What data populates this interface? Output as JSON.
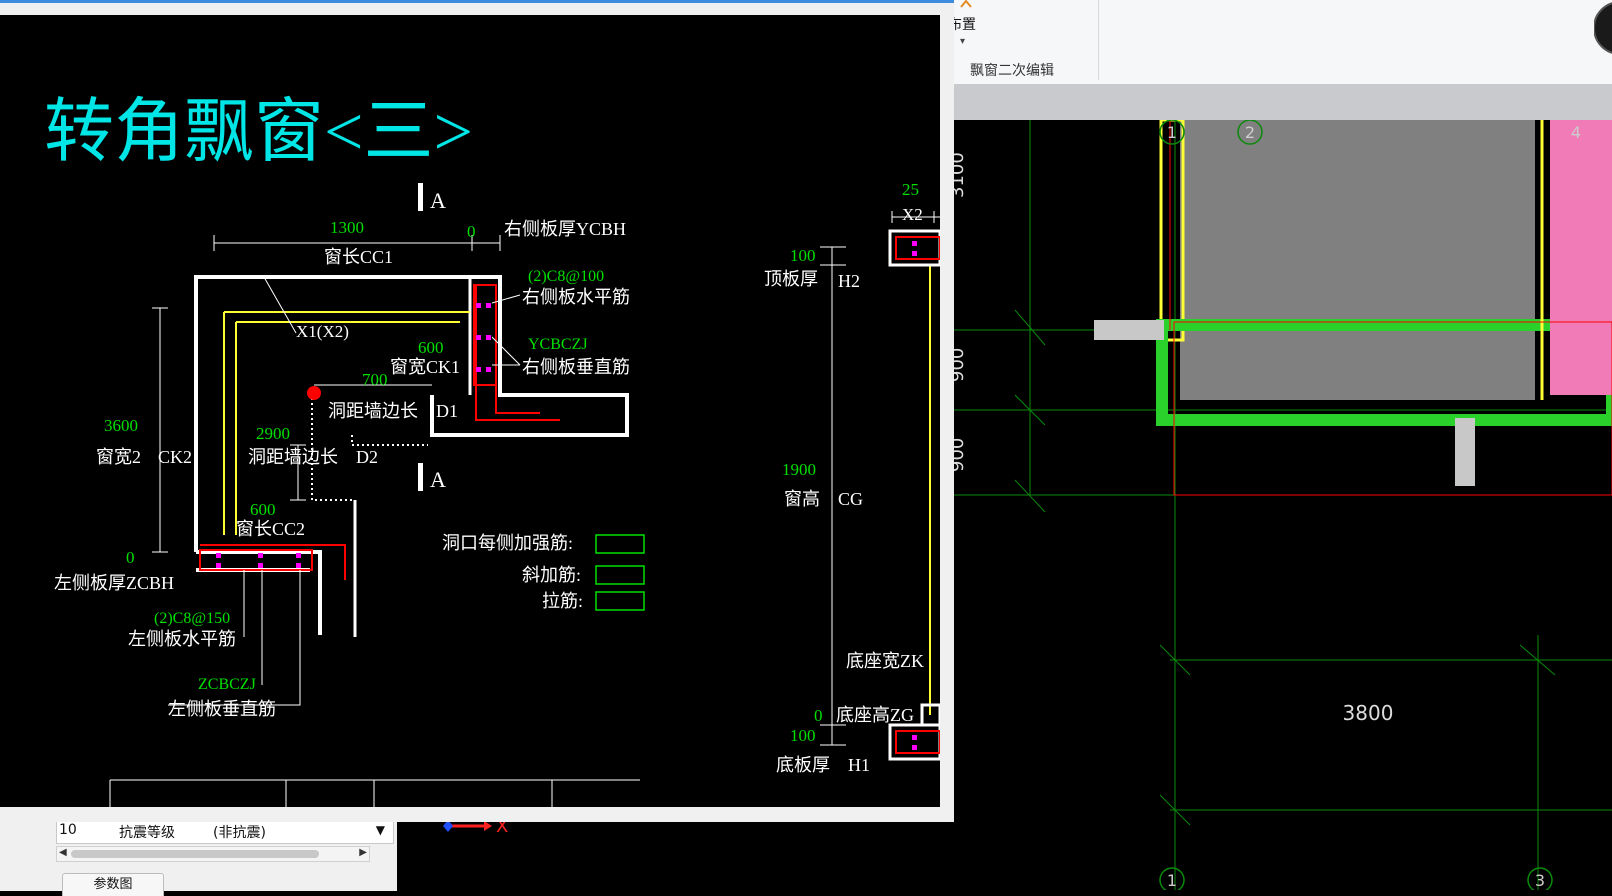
{
  "ribbon": {
    "button_label": "布置",
    "dropdown_arrow": "▾",
    "group_label": "飘窗二次编辑"
  },
  "diagram": {
    "title": "转角飘窗<三>",
    "section_mark": "A",
    "dims": {
      "cc1_value": "1300",
      "cc1_label": "窗长CC1",
      "ycbh_value": "0",
      "ycbh_label": "右侧板厚YCBH",
      "right_h_rebar": "(2)C8@100",
      "right_h_label": "右侧板水平筋",
      "x1x2": "X1(X2)",
      "ck1_value": "600",
      "ck1_label": "窗宽CK1",
      "ycbczj": "YCBCZJ",
      "right_v_label": "右侧板垂直筋",
      "d1_value": "700",
      "d1_label": "洞距墙边长",
      "d1_tag": "D1",
      "ck2_value": "3600",
      "ck2_label": "窗宽2",
      "ck2_tag": "CK2",
      "d2_value": "2900",
      "d2_label": "洞距墙边长",
      "d2_tag": "D2",
      "cc2_value": "600",
      "cc2_label": "窗长CC2",
      "zcbh_value": "0",
      "zcbh_label": "左侧板厚ZCBH",
      "left_h_rebar": "(2)C8@150",
      "left_h_label": "左侧板水平筋",
      "zcbczj": "ZCBCZJ",
      "left_v_label": "左侧板垂直筋",
      "rebar1_label": "洞口每侧加强筋:",
      "rebar2_label": "斜加筋:",
      "rebar3_label": "拉筋:",
      "x2_value": "25",
      "x2_label": "X2",
      "h2_value": "100",
      "h2_label": "顶板厚",
      "h2_tag": "H2",
      "cg_value": "1900",
      "cg_label": "窗高",
      "cg_tag": "CG",
      "zk_label": "底座宽ZK",
      "zg_value": "0",
      "zg_label": "底座高ZG",
      "h1_value": "100",
      "h1_label": "底板厚",
      "h1_tag": "H1"
    }
  },
  "params": {
    "row_number": "10",
    "row_name": "抗震等级",
    "row_value": "(非抗震)",
    "tab_label": "参数图"
  },
  "axis_indicator": {
    "x_label": "X"
  },
  "plan": {
    "dim_top": "3100",
    "dim_mid": "900",
    "dim_low": "900",
    "dim_bottom": "3800",
    "axis_1": "1",
    "axis_2": "2",
    "axis_3": "3",
    "axis_4": "4"
  },
  "colors": {
    "cyan": "#00e5e5",
    "green_text": "#00e000",
    "magenta": "#ff00ff",
    "red": "#ff0000",
    "yellow": "#ffff33",
    "grid_green": "#0a8a0a",
    "pink_fill": "#f07bb6",
    "wall_green": "#2bd12b"
  }
}
